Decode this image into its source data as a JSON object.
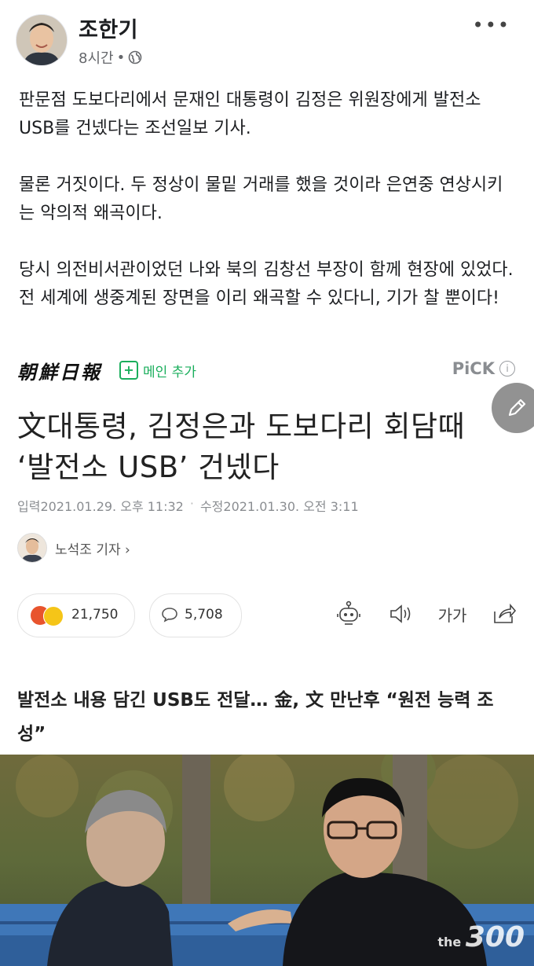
{
  "post": {
    "author": "조한기",
    "time": "8시간",
    "separator": "•",
    "more": "•••",
    "paragraphs": [
      "판문점 도보다리에서 문재인 대통령이 김정은 위원장에게 발전소 USB를 건넸다는 조선일보 기사.",
      "물론 거짓이다. 두 정상이 물밑 거래를 했을 것이라 은연중 연상시키는 악의적 왜곡이다.",
      "당시 의전비서관이었던 나와 북의 김창선 부장이 함께 현장에 있었다. 전 세계에 생중계된 장면을 이리 왜곡할 수 있다니, 기가 찰 뿐이다!"
    ]
  },
  "article": {
    "publisher": "朝鮮日報",
    "add_main": "메인 추가",
    "pick": "PiCK",
    "headline_line1": "文대통령, 김정은과 도보다리 회담때",
    "headline_line2": "‘발전소 USB’ 건넸다",
    "date_input": "입력2021.01.29. 오후 11:32",
    "date_dot": "·",
    "date_modified": "수정2021.01.30. 오전 3:11",
    "reporter": "노석조 기자 ›",
    "reaction_count": "21,750",
    "comment_count": "5,708",
    "font_size_label": "가가",
    "subhead": "발전소 내용 담긴 USB도 전달… 金, 文 만난후 “원전 능력 조성”",
    "watermark_small": "the",
    "watermark_big": "300"
  },
  "colors": {
    "accent_green": "#1aae5c",
    "meta_gray": "#65676b"
  }
}
